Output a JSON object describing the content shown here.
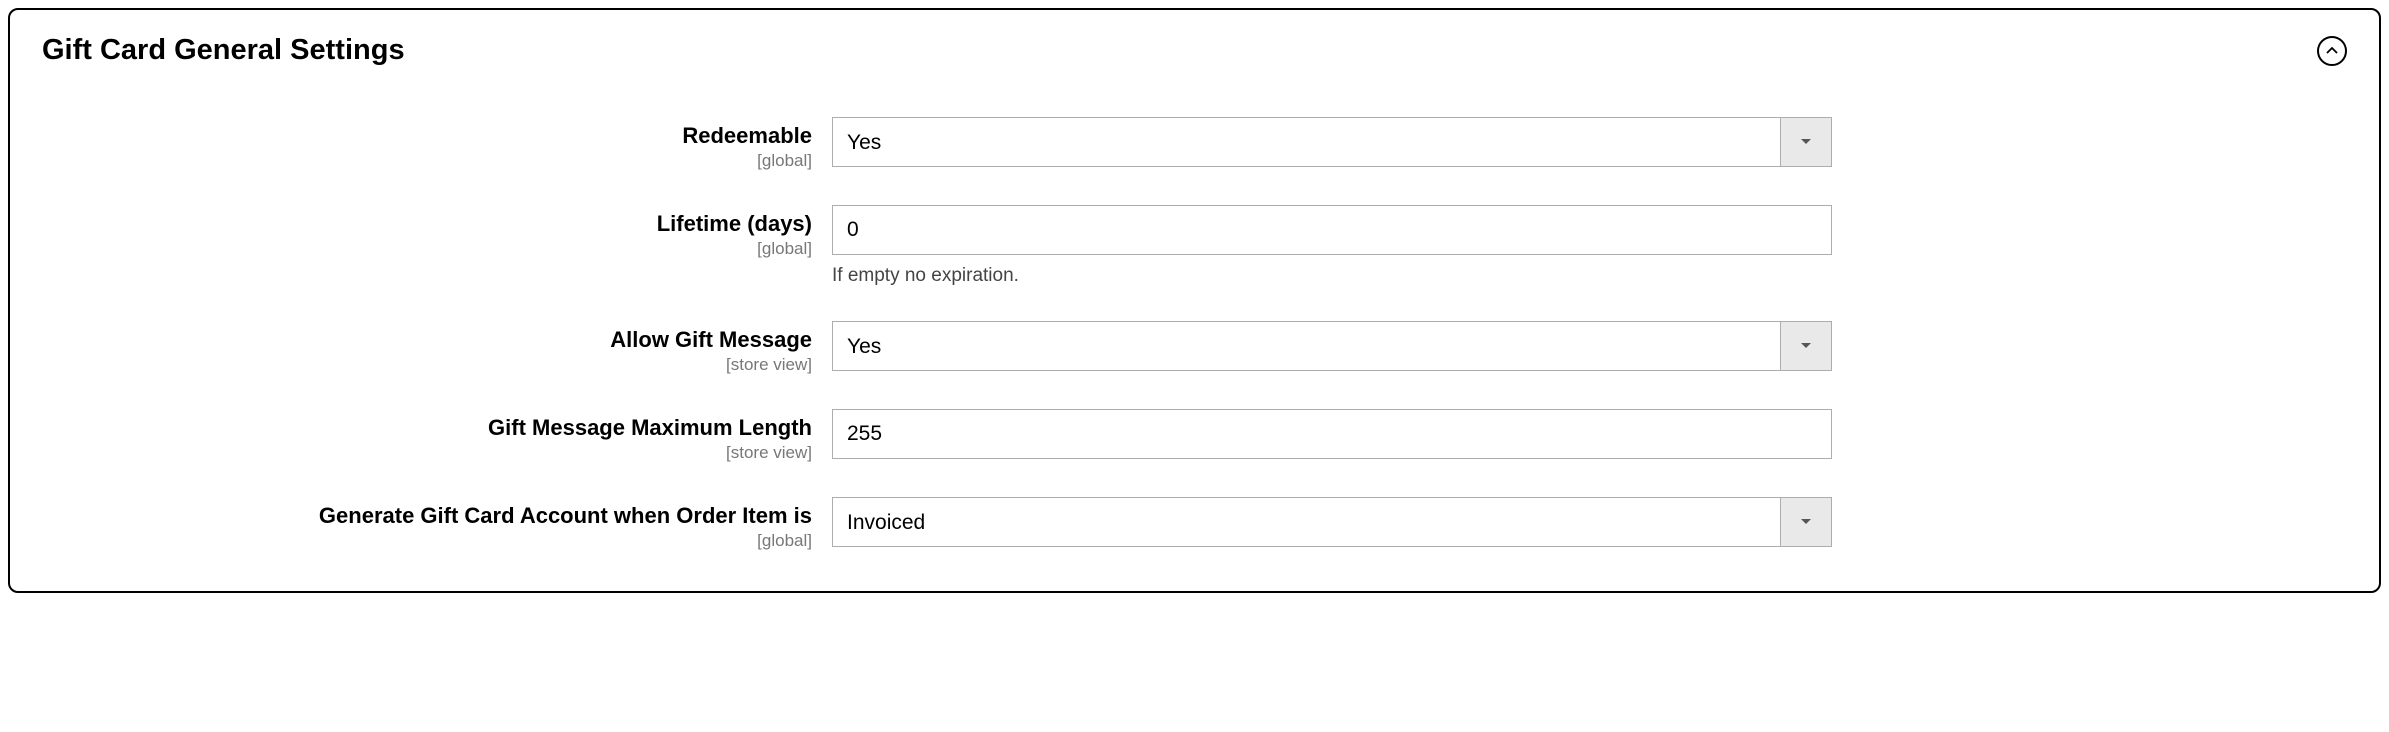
{
  "panel": {
    "title": "Gift Card General Settings"
  },
  "scopes": {
    "global": "[global]",
    "store_view": "[store view]"
  },
  "fields": {
    "redeemable": {
      "label": "Redeemable",
      "value": "Yes"
    },
    "lifetime": {
      "label": "Lifetime (days)",
      "value": "0",
      "hint": "If empty no expiration."
    },
    "allow_gift_message": {
      "label": "Allow Gift Message",
      "value": "Yes"
    },
    "gift_message_max_length": {
      "label": "Gift Message Maximum Length",
      "value": "255"
    },
    "generate_account_when": {
      "label": "Generate Gift Card Account when Order Item is",
      "value": "Invoiced"
    }
  }
}
